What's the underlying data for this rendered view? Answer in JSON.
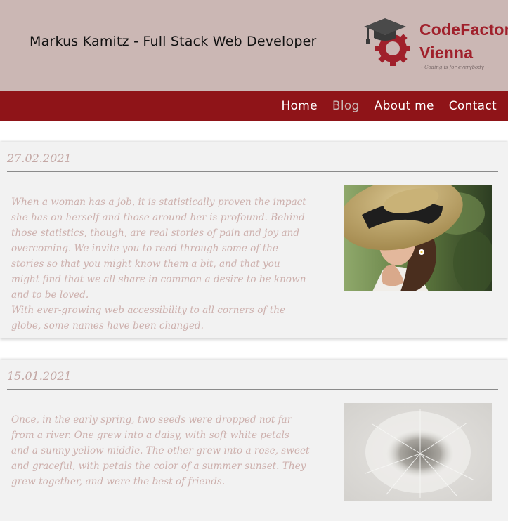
{
  "header": {
    "site_title": "Markus Kamitz - Full Stack Web Developer",
    "logo": {
      "line1": "CodeFactory",
      "line2": "Vienna",
      "tagline": "~ Coding is for everybody ~",
      "icon": "graduation-cap-gear-icon"
    }
  },
  "nav": {
    "items": [
      {
        "label": "Home",
        "active": false
      },
      {
        "label": "Blog",
        "active": true
      },
      {
        "label": "About me",
        "active": false
      },
      {
        "label": "Contact",
        "active": false
      }
    ]
  },
  "posts": [
    {
      "date": "27.02.2021",
      "paragraphs": [
        "When a woman has a job, it is statistically proven the impact she has on herself and those around her is profound. Behind those statistics, though, are real stories of pain and joy and overcoming. We invite you to read through some of the stories so that you might know them a bit, and that you might find that we all share in common a desire to be known and to be loved.",
        "With ever-growing web accessibility to all corners of the globe, some names have been changed."
      ],
      "image": "woman-in-sun-hat-photo"
    },
    {
      "date": "15.01.2021",
      "paragraphs": [
        "Once, in the early spring, two seeds were dropped not far from a river. One grew into a daisy, with soft white petals and a sunny yellow middle. The other grew into a rose, sweet and graceful, with petals the color of a summer sunset. They grew together, and were the best of friends."
      ],
      "image": "dandelion-seed-head-photo"
    }
  ],
  "colors": {
    "header_bg": "#cbb7b4",
    "nav_bg": "#8f1418",
    "brand_red": "#a0202b",
    "post_text": "#cdb0ad"
  }
}
